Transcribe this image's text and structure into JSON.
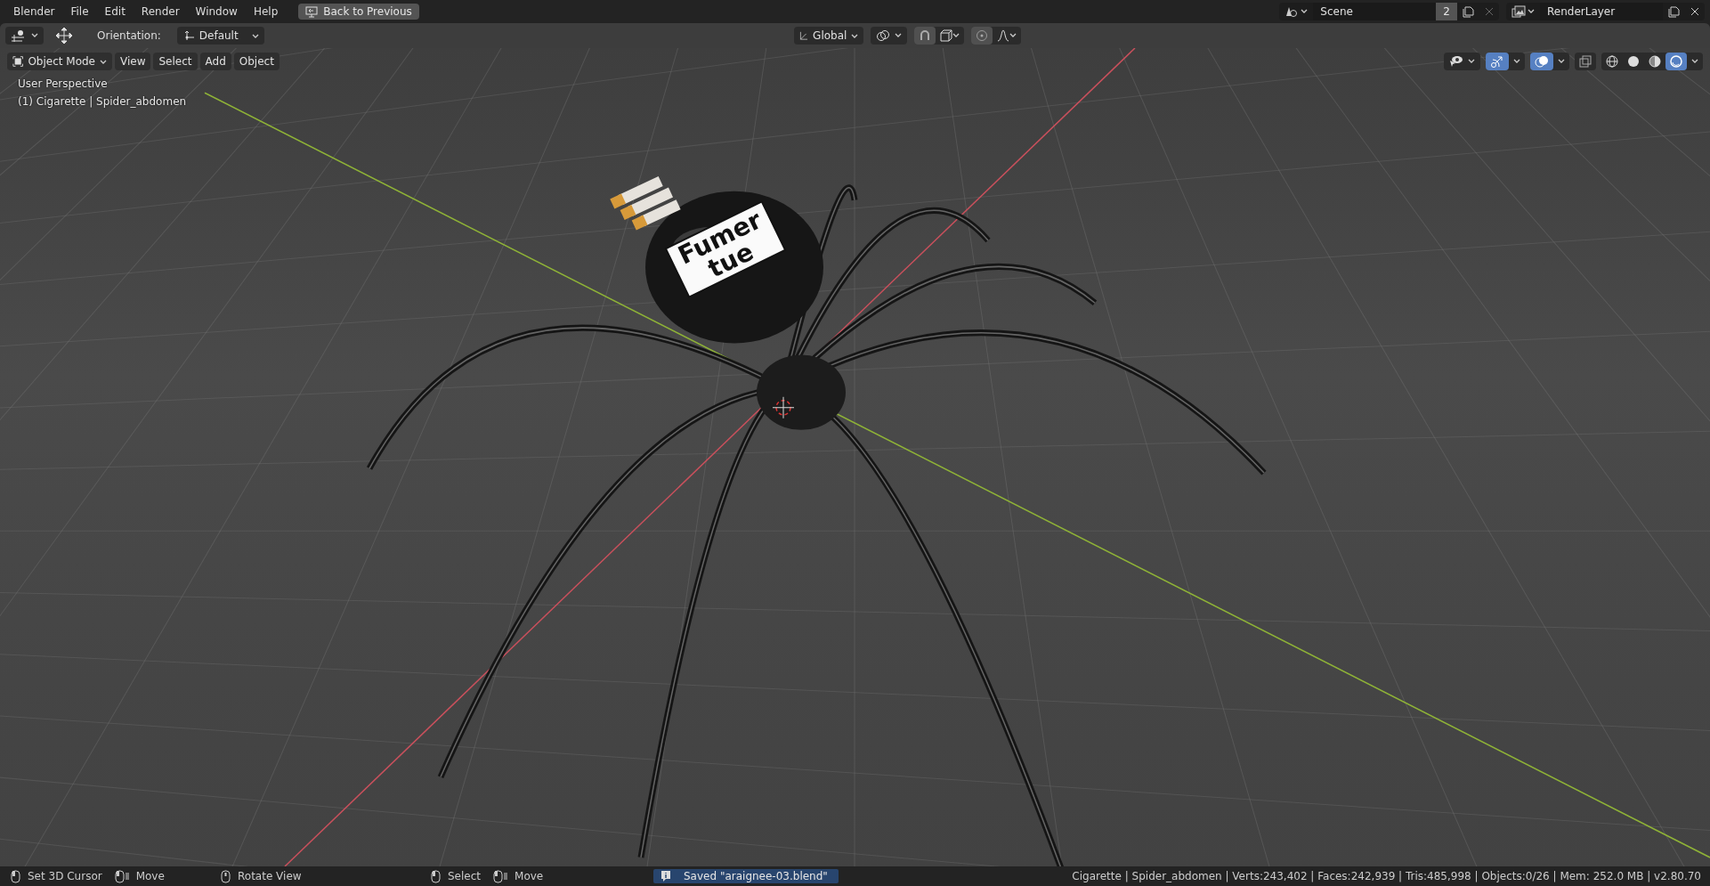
{
  "menu_bar": {
    "app_menu": "Blender",
    "menus": [
      "File",
      "Edit",
      "Render",
      "Window",
      "Help"
    ],
    "back_button": "Back to Previous"
  },
  "scene": {
    "name": "Scene",
    "users": "2"
  },
  "view_layer": {
    "name": "RenderLayer"
  },
  "tool_header": {
    "orientation_label": "Orientation:",
    "orientation_value": "Default",
    "transform_orientation": "Global"
  },
  "viewport_header": {
    "mode": "Object Mode",
    "menus": [
      "View",
      "Select",
      "Add",
      "Object"
    ],
    "gizmos_on": true,
    "overlays_on": true,
    "xray_on": false
  },
  "viewport_shading": {
    "modes": [
      {
        "kind": "wireframe",
        "selected": false
      },
      {
        "kind": "solid",
        "selected": false
      },
      {
        "kind": "material",
        "selected": false
      },
      {
        "kind": "rendered",
        "selected": true
      }
    ]
  },
  "viewport": {
    "view_name": "User Perspective",
    "object_info": "(1) Cigarette | Spider_abdomen",
    "model_label": "Fumer tue"
  },
  "status_bar": {
    "hint_groups": [
      [
        {
          "kind": "mouse-left",
          "label": "Set 3D Cursor"
        },
        {
          "kind": "mouse-drag",
          "label": "Move"
        }
      ],
      [
        {
          "kind": "mouse-middle",
          "label": "Rotate View"
        }
      ],
      [
        {
          "kind": "mouse-left",
          "label": "Select"
        },
        {
          "kind": "mouse-drag",
          "label": "Move"
        }
      ]
    ],
    "report": "Saved \"araignee-03.blend\"",
    "stats": "Cigarette | Spider_abdomen | Verts:243,402 | Faces:242,939 | Tris:485,998 | Objects:0/26 | Mem: 252.0 MB | v2.80.70"
  }
}
